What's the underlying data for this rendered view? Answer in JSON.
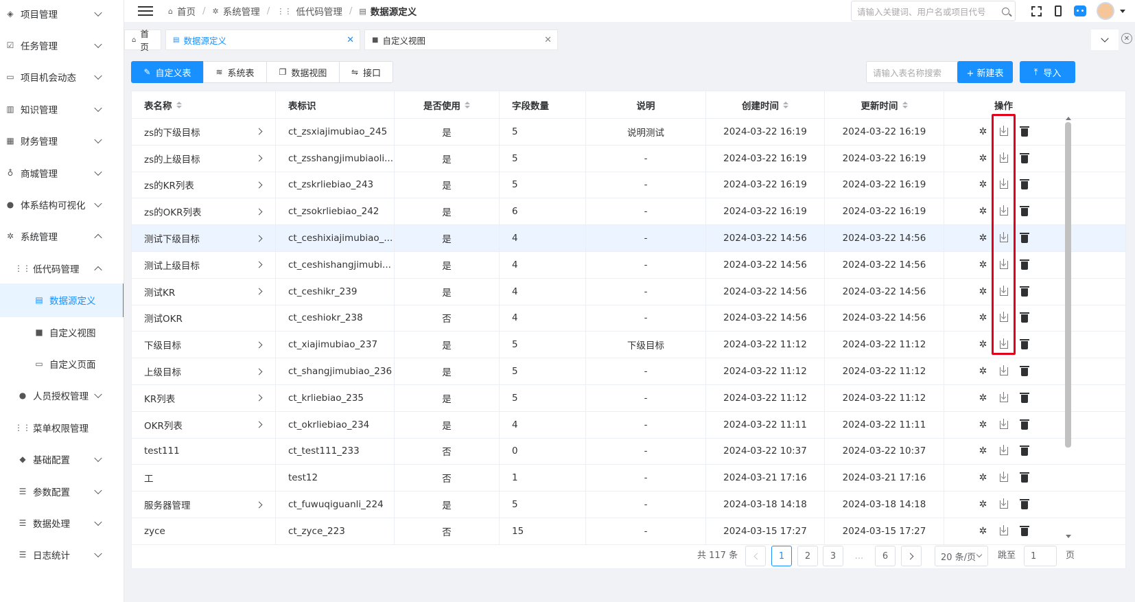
{
  "sidebar": {
    "items": [
      {
        "label": "项目管理",
        "icon": "layers-icon",
        "glyph": "◈",
        "level": 1,
        "chevron": "down"
      },
      {
        "label": "任务管理",
        "icon": "calendar-check-icon",
        "glyph": "☑",
        "level": 1,
        "chevron": "down"
      },
      {
        "label": "项目机会动态",
        "icon": "calendar-icon",
        "glyph": "▭",
        "level": 1,
        "chevron": "down"
      },
      {
        "label": "知识管理",
        "icon": "book-icon",
        "glyph": "▥",
        "level": 1,
        "chevron": "down"
      },
      {
        "label": "财务管理",
        "icon": "table-icon",
        "glyph": "▦",
        "level": 1,
        "chevron": "down"
      },
      {
        "label": "商城管理",
        "icon": "bike-icon",
        "glyph": "♁",
        "level": 1,
        "chevron": "down"
      },
      {
        "label": "体系结构可视化",
        "icon": "user-tie-icon",
        "glyph": "●",
        "level": 1,
        "chevron": "down"
      },
      {
        "label": "系统管理",
        "icon": "gear-icon",
        "glyph": "✲",
        "level": 1,
        "chevron": "up"
      },
      {
        "label": "低代码管理",
        "icon": "grid-icon",
        "glyph": "⋮⋮",
        "level": 2,
        "chevron": "up"
      },
      {
        "label": "数据源定义",
        "icon": "document-icon",
        "glyph": "▤",
        "level": 3,
        "chevron": "",
        "active": true
      },
      {
        "label": "自定义视图",
        "icon": "file-icon",
        "glyph": "■",
        "level": 3,
        "chevron": ""
      },
      {
        "label": "自定义页面",
        "icon": "window-icon",
        "glyph": "▭",
        "level": 3,
        "chevron": ""
      },
      {
        "label": "人员授权管理",
        "icon": "user-circle-icon",
        "glyph": "●",
        "level": 2,
        "chevron": "down"
      },
      {
        "label": "菜单权限管理",
        "icon": "grid-icon",
        "glyph": "⋮⋮",
        "level": 2,
        "chevron": ""
      },
      {
        "label": "基础配置",
        "icon": "cube-icon",
        "glyph": "◆",
        "level": 2,
        "chevron": "down"
      },
      {
        "label": "参数配置",
        "icon": "filter-icon",
        "glyph": "☰",
        "level": 2,
        "chevron": "down"
      },
      {
        "label": "数据处理",
        "icon": "filter-icon",
        "glyph": "☰",
        "level": 2,
        "chevron": "down"
      },
      {
        "label": "日志统计",
        "icon": "filter-icon",
        "glyph": "☰",
        "level": 2,
        "chevron": "down"
      }
    ]
  },
  "breadcrumb": [
    {
      "label": "首页",
      "icon": "home-icon",
      "glyph": "⌂"
    },
    {
      "label": "系统管理",
      "icon": "gear-icon",
      "glyph": "✲"
    },
    {
      "label": "低代码管理",
      "icon": "grid-icon",
      "glyph": "⋮⋮"
    },
    {
      "label": "数据源定义",
      "icon": "document-icon",
      "glyph": "▤"
    }
  ],
  "header": {
    "search_placeholder": "请输入关键词、用户名或项目代号"
  },
  "tabs": [
    {
      "label": "首页",
      "icon": "home-icon",
      "glyph": "⌂",
      "closable": false,
      "active": false
    },
    {
      "label": "数据源定义",
      "icon": "document-icon",
      "glyph": "▤",
      "closable": true,
      "active": true
    },
    {
      "label": "自定义视图",
      "icon": "file-icon",
      "glyph": "■",
      "closable": true,
      "active": false
    }
  ],
  "toolbar": {
    "segments": [
      {
        "label": "自定义表",
        "icon": "edit-icon",
        "glyph": "✎",
        "active": true
      },
      {
        "label": "系统表",
        "icon": "database-icon",
        "glyph": "≋",
        "active": false
      },
      {
        "label": "数据视图",
        "icon": "copy-icon",
        "glyph": "❐",
        "active": false
      },
      {
        "label": "接口",
        "icon": "api-icon",
        "glyph": "⇋",
        "active": false
      }
    ],
    "search_placeholder": "请输入表名称搜索",
    "new_label": "+ 新建表",
    "import_label": "导入",
    "import_glyph": "⤒"
  },
  "table": {
    "columns": [
      {
        "label": "表名称",
        "sortable": true
      },
      {
        "label": "表标识",
        "sortable": false
      },
      {
        "label": "是否使用",
        "sortable": true
      },
      {
        "label": "字段数量",
        "sortable": false
      },
      {
        "label": "说明",
        "sortable": false
      },
      {
        "label": "创建时间",
        "sortable": true
      },
      {
        "label": "更新时间",
        "sortable": true
      },
      {
        "label": "操作",
        "sortable": false
      }
    ],
    "rows": [
      {
        "name": "zs的下级目标",
        "key": "ct_zsxiajimubiao_245",
        "used": "是",
        "fields": "5",
        "desc": "说明测试",
        "created": "2024-03-22 16:19",
        "updated": "2024-03-22 16:19",
        "expand": true
      },
      {
        "name": "zs的上级目标",
        "key": "ct_zsshangjimubiaoli...",
        "used": "是",
        "fields": "5",
        "desc": "-",
        "created": "2024-03-22 16:19",
        "updated": "2024-03-22 16:19",
        "expand": true
      },
      {
        "name": "zs的KR列表",
        "key": "ct_zskrliebiao_243",
        "used": "是",
        "fields": "5",
        "desc": "-",
        "created": "2024-03-22 16:19",
        "updated": "2024-03-22 16:19",
        "expand": true
      },
      {
        "name": "zs的OKR列表",
        "key": "ct_zsokrliebiao_242",
        "used": "是",
        "fields": "6",
        "desc": "-",
        "created": "2024-03-22 16:19",
        "updated": "2024-03-22 16:19",
        "expand": true
      },
      {
        "name": "测试下级目标",
        "key": "ct_ceshixiajimubiao_...",
        "used": "是",
        "fields": "4",
        "desc": "-",
        "created": "2024-03-22 14:56",
        "updated": "2024-03-22 14:56",
        "expand": true,
        "highlight": true
      },
      {
        "name": "测试上级目标",
        "key": "ct_ceshishangjimubi...",
        "used": "是",
        "fields": "4",
        "desc": "-",
        "created": "2024-03-22 14:56",
        "updated": "2024-03-22 14:56",
        "expand": true
      },
      {
        "name": "测试KR",
        "key": "ct_ceshikr_239",
        "used": "是",
        "fields": "4",
        "desc": "-",
        "created": "2024-03-22 14:56",
        "updated": "2024-03-22 14:56",
        "expand": true
      },
      {
        "name": "测试OKR",
        "key": "ct_ceshiokr_238",
        "used": "否",
        "fields": "4",
        "desc": "-",
        "created": "2024-03-22 14:56",
        "updated": "2024-03-22 14:56",
        "expand": false
      },
      {
        "name": "下级目标",
        "key": "ct_xiajimubiao_237",
        "used": "是",
        "fields": "5",
        "desc": "下级目标",
        "created": "2024-03-22 11:12",
        "updated": "2024-03-22 11:12",
        "expand": true
      },
      {
        "name": "上级目标",
        "key": "ct_shangjimubiao_236",
        "used": "是",
        "fields": "5",
        "desc": "-",
        "created": "2024-03-22 11:12",
        "updated": "2024-03-22 11:12",
        "expand": true
      },
      {
        "name": "KR列表",
        "key": "ct_krliebiao_235",
        "used": "是",
        "fields": "5",
        "desc": "-",
        "created": "2024-03-22 11:12",
        "updated": "2024-03-22 11:12",
        "expand": true
      },
      {
        "name": "OKR列表",
        "key": "ct_okrliebiao_234",
        "used": "是",
        "fields": "4",
        "desc": "-",
        "created": "2024-03-22 11:11",
        "updated": "2024-03-22 11:11",
        "expand": true
      },
      {
        "name": "test111",
        "key": "ct_test111_233",
        "used": "否",
        "fields": "0",
        "desc": "-",
        "created": "2024-03-22 10:37",
        "updated": "2024-03-22 10:37",
        "expand": false
      },
      {
        "name": "工",
        "key": "test12",
        "used": "否",
        "fields": "1",
        "desc": "-",
        "created": "2024-03-21 17:16",
        "updated": "2024-03-21 17:16",
        "expand": false
      },
      {
        "name": "服务器管理",
        "key": "ct_fuwuqiguanli_224",
        "used": "是",
        "fields": "5",
        "desc": "-",
        "created": "2024-03-18 14:18",
        "updated": "2024-03-18 14:18",
        "expand": true
      },
      {
        "name": "zyce",
        "key": "ct_zyce_223",
        "used": "否",
        "fields": "15",
        "desc": "-",
        "created": "2024-03-15 17:27",
        "updated": "2024-03-15 17:27",
        "expand": false
      }
    ]
  },
  "pagination": {
    "total_text": "共 117 条",
    "pages": [
      "1",
      "2",
      "3",
      "...",
      "6"
    ],
    "current": "1",
    "page_size": "20 条/页",
    "jump_label": "跳至",
    "jump_value": "1",
    "jump_suffix": "页"
  },
  "colors": {
    "primary": "#1890ff",
    "annotation_red": "#e4001b",
    "row_highlight": "#ecf5ff"
  }
}
